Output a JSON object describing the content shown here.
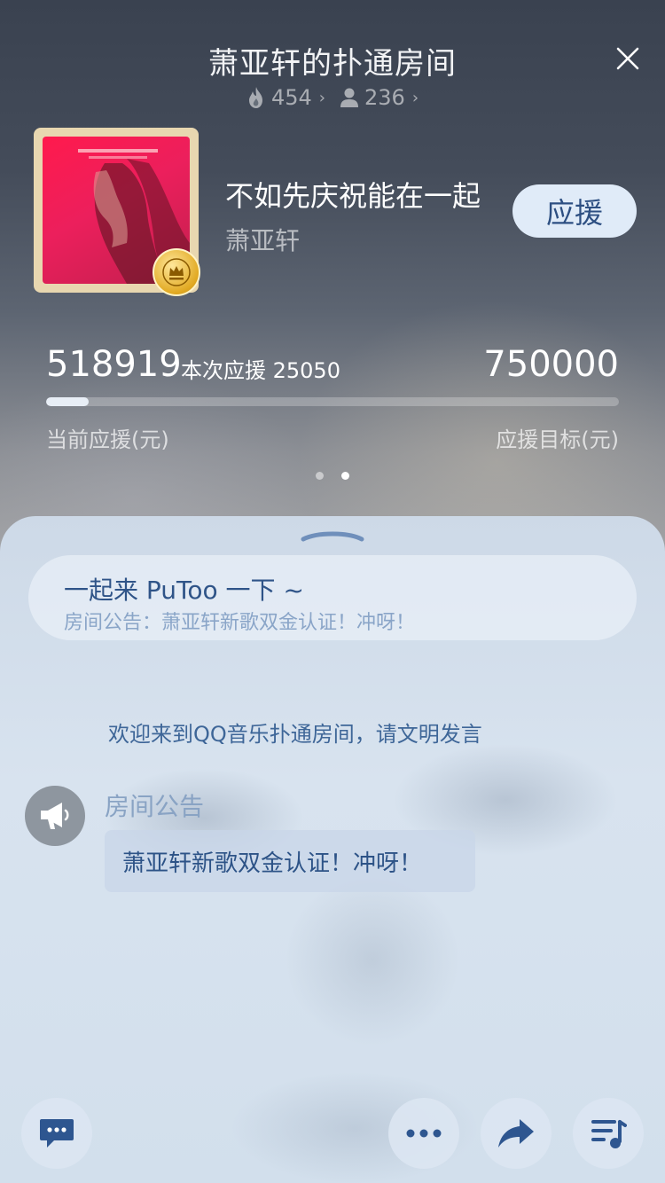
{
  "header": {
    "title": "萧亚轩的扑通房间",
    "heat_count": "454",
    "member_count": "236"
  },
  "song": {
    "title": "不如先庆祝能在一起",
    "artist": "萧亚轩",
    "support_label": "应援"
  },
  "funding": {
    "current": "518919",
    "this_time": "本次应援 25050",
    "target": "750000",
    "current_label": "当前应援(元)",
    "target_label": "应援目标(元)",
    "progress_fraction": 0.075
  },
  "pager": {
    "count": 2,
    "active_index": 1
  },
  "chat": {
    "notice_title": "一起来 PuToo 一下 ~",
    "notice_subtitle": "房间公告：萧亚轩新歌双金认证！冲呀！",
    "welcome": "欢迎来到QQ音乐扑通房间，请文明发言",
    "announcement_sender": "房间公告",
    "announcement_text": "萧亚轩新歌双金认证！冲呀！"
  },
  "icons": {
    "close": "close-icon",
    "fire": "fire-icon",
    "person": "person-icon",
    "megaphone": "megaphone-icon",
    "comment": "comment-icon",
    "more": "more-icon",
    "share": "share-icon",
    "playlist": "playlist-icon"
  },
  "colors": {
    "accent": "#2d4f82",
    "button_bg": "#e0ebf8",
    "badge_gold": "#e1a922"
  }
}
